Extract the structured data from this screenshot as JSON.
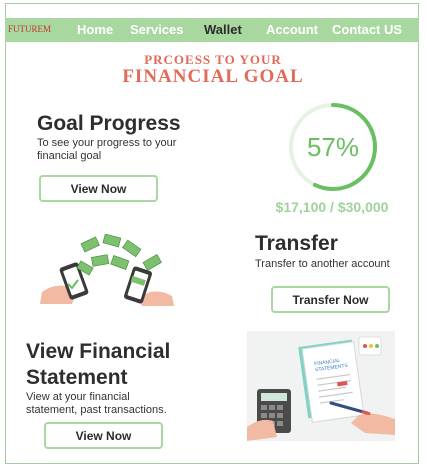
{
  "brand": "FUTUREM",
  "nav": {
    "items": [
      "Home",
      "Services",
      "Wallet",
      "Account",
      "Contact US"
    ],
    "active": "Wallet"
  },
  "hero": {
    "line1": "PRCOESS TO YOUR",
    "line2": "FINANCIAL GOAL"
  },
  "goal": {
    "title": "Goal Progress",
    "subtitle_line1": "To see your progress to your",
    "subtitle_line2": "financial goal",
    "button": "View Now",
    "percent_label": "57%",
    "progress_fraction": 0.57,
    "amount": "$17,100 / $30,000"
  },
  "transfer": {
    "title": "Transfer",
    "subtitle": "Transfer to another account",
    "button": "Transfer Now"
  },
  "statement": {
    "title_line1": "View Financial",
    "title_line2": "Statement",
    "subtitle_line1": "View at your financial",
    "subtitle_line2": "statement, past transactions.",
    "button": "View Now",
    "document_label_line1": "FINANCIAL",
    "document_label_line2": "STATEMENTS"
  },
  "colors": {
    "nav_bg": "#a8d8a0",
    "accent_green": "#6bbf63",
    "hero_red": "#e26a5a",
    "button_border": "#a8d8a0"
  },
  "icons": [
    "money-transfer-illustration",
    "financial-statement-illustration"
  ]
}
